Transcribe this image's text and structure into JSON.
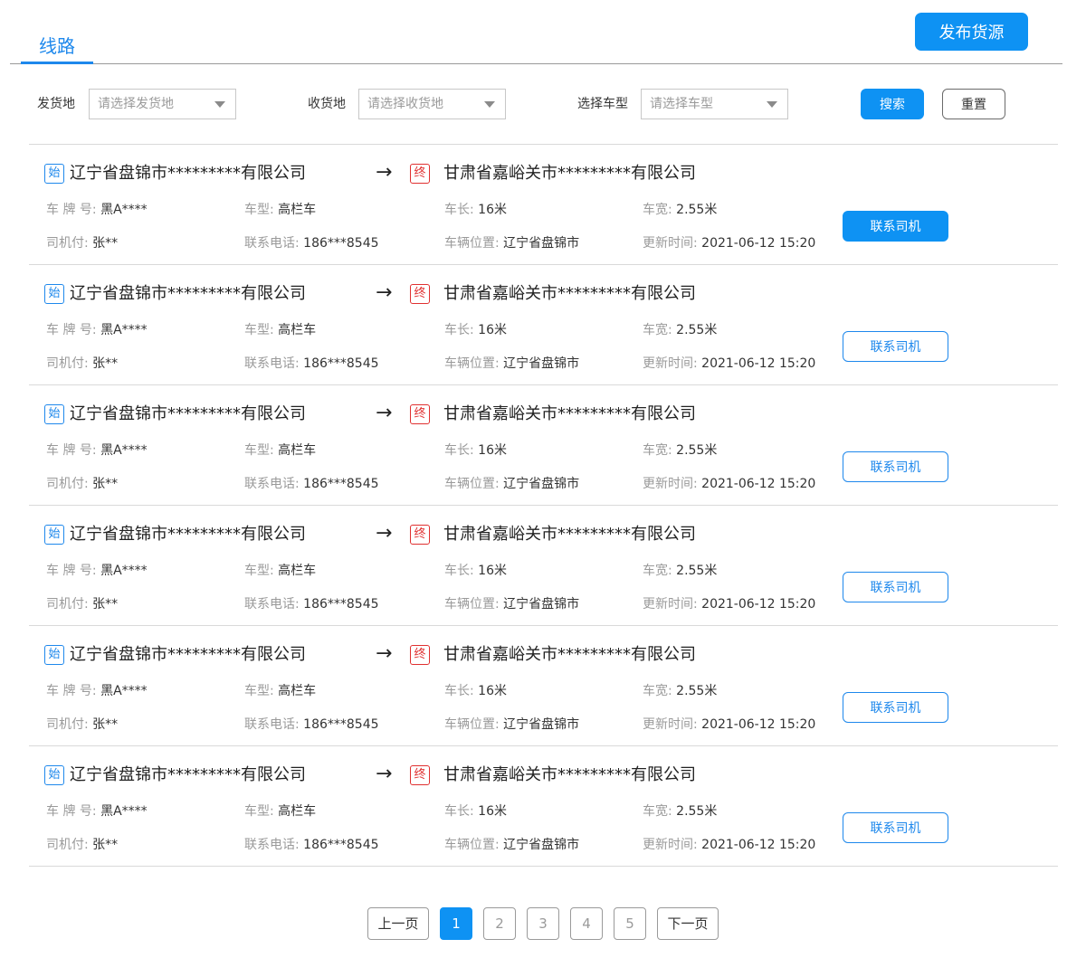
{
  "header": {
    "tab_label": "线路",
    "publish_label": "发布货源"
  },
  "filters": {
    "origin_label": "发货地",
    "origin_placeholder": "请选择发货地",
    "dest_label": "收货地",
    "dest_placeholder": "请选择收货地",
    "vehicle_label": "选择车型",
    "vehicle_placeholder": "请选择车型",
    "search_label": "搜索",
    "reset_label": "重置"
  },
  "labels": {
    "start_badge": "始",
    "end_badge": "终",
    "arrow": "→",
    "plate": "车 牌 号:",
    "vtype": "车型:",
    "length": "车长:",
    "width": "车宽:",
    "driver": "司机付:",
    "phone": "联系电话:",
    "location": "车辆位置:",
    "updated": "更新时间:",
    "contact": "联系司机"
  },
  "routes": [
    {
      "from": "辽宁省盘锦市*********有限公司",
      "to": "甘肃省嘉峪关市*********有限公司",
      "plate": "黑A****",
      "vtype": "高栏车",
      "length": "16米",
      "width": "2.55米",
      "driver": "张**",
      "phone": "186***8545",
      "location": "辽宁省盘锦市",
      "updated": "2021-06-12 15:20",
      "highlighted": true
    },
    {
      "from": "辽宁省盘锦市*********有限公司",
      "to": "甘肃省嘉峪关市*********有限公司",
      "plate": "黑A****",
      "vtype": "高栏车",
      "length": "16米",
      "width": "2.55米",
      "driver": "张**",
      "phone": "186***8545",
      "location": "辽宁省盘锦市",
      "updated": "2021-06-12 15:20",
      "highlighted": false
    },
    {
      "from": "辽宁省盘锦市*********有限公司",
      "to": "甘肃省嘉峪关市*********有限公司",
      "plate": "黑A****",
      "vtype": "高栏车",
      "length": "16米",
      "width": "2.55米",
      "driver": "张**",
      "phone": "186***8545",
      "location": "辽宁省盘锦市",
      "updated": "2021-06-12 15:20",
      "highlighted": false
    },
    {
      "from": "辽宁省盘锦市*********有限公司",
      "to": "甘肃省嘉峪关市*********有限公司",
      "plate": "黑A****",
      "vtype": "高栏车",
      "length": "16米",
      "width": "2.55米",
      "driver": "张**",
      "phone": "186***8545",
      "location": "辽宁省盘锦市",
      "updated": "2021-06-12 15:20",
      "highlighted": false
    },
    {
      "from": "辽宁省盘锦市*********有限公司",
      "to": "甘肃省嘉峪关市*********有限公司",
      "plate": "黑A****",
      "vtype": "高栏车",
      "length": "16米",
      "width": "2.55米",
      "driver": "张**",
      "phone": "186***8545",
      "location": "辽宁省盘锦市",
      "updated": "2021-06-12 15:20",
      "highlighted": false
    },
    {
      "from": "辽宁省盘锦市*********有限公司",
      "to": "甘肃省嘉峪关市*********有限公司",
      "plate": "黑A****",
      "vtype": "高栏车",
      "length": "16米",
      "width": "2.55米",
      "driver": "张**",
      "phone": "186***8545",
      "location": "辽宁省盘锦市",
      "updated": "2021-06-12 15:20",
      "highlighted": false
    }
  ],
  "pagination": {
    "prev_label": "上一页",
    "next_label": "下一页",
    "pages": [
      "1",
      "2",
      "3",
      "4",
      "5"
    ],
    "current_page": "1"
  },
  "colors": {
    "accent": "#0e92f3",
    "link": "#1e88ec",
    "end_badge": "#e03030"
  }
}
